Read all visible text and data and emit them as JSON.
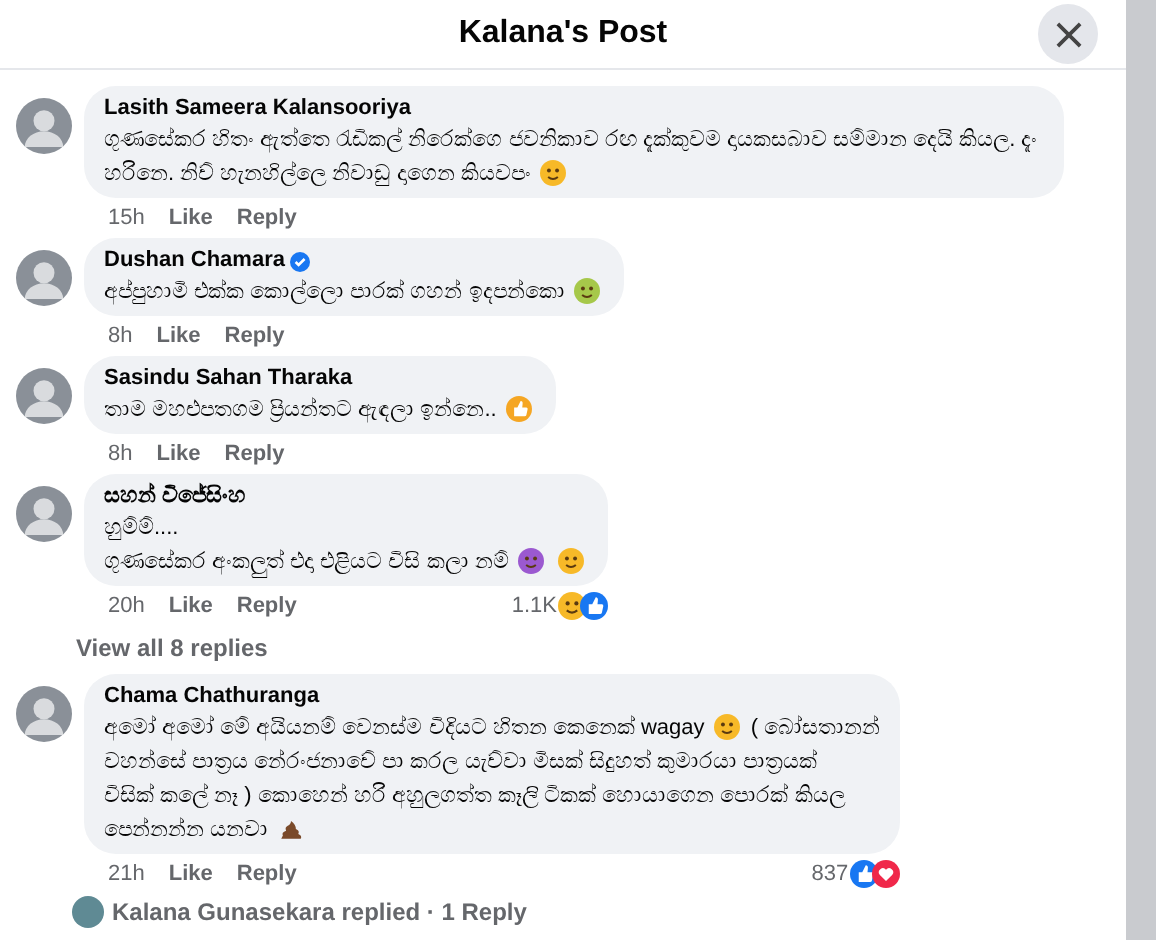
{
  "dialog": {
    "title": "Kalana's Post"
  },
  "comments": [
    {
      "author": "Lasith Sameera Kalansooriya",
      "verified": false,
      "content": [
        {
          "kind": "text",
          "text": "ගුණසේකර හිතං ඇත්තෙ රැඩිකල් නිරෙක්ගෙ ජවනිකාව රඟ දැක්කුවම දායකසබාව සම්මාන දෙයි කියල. දැං හරිනෙ. නිව් හැනහිල්ලෙ නිවාඩු දාගෙන කියවපං"
        },
        {
          "kind": "kiss"
        }
      ],
      "time": "15h",
      "like": "Like",
      "reply": "Reply"
    },
    {
      "author": "Dushan Chamara",
      "verified": true,
      "content": [
        {
          "kind": "text",
          "text": "අප්පුහාමි එක්ක කොල්ලො පාරක් ගහන් ඉදපන්කො"
        },
        {
          "kind": "sick"
        }
      ],
      "time": "8h",
      "like": "Like",
      "reply": "Reply"
    },
    {
      "author": "Sasindu Sahan Tharaka",
      "verified": false,
      "content": [
        {
          "kind": "text",
          "text": "තාම මහළුපතගම ප්‍රියන්තට ඇඳලා ඉන්නෙ.."
        },
        {
          "kind": "thumb"
        }
      ],
      "time": "8h",
      "like": "Like",
      "reply": "Reply"
    },
    {
      "author": "සහන් විජේසිංහ",
      "verified": false,
      "content": [
        {
          "kind": "text",
          "text": "හුම්ම්...."
        },
        {
          "kind": "break"
        },
        {
          "kind": "text",
          "text": "ගුණසේකර අංකලුත් එදා එළියට විසි කලා නම්"
        },
        {
          "kind": "shock"
        },
        {
          "kind": "smirk"
        }
      ],
      "time": "20h",
      "like": "Like",
      "reply": "Reply",
      "reaction_count": "1.1K",
      "reactions": [
        {
          "kind": "haha"
        },
        {
          "kind": "like"
        }
      ],
      "view_replies": "View all 8 replies"
    },
    {
      "author": "Chama Chathuranga",
      "verified": false,
      "content": [
        {
          "kind": "text",
          "text": "අමෝ අමෝ මේ අයියනම් වෙනස්ම විදියට හිතන කෙනෙක් wagay"
        },
        {
          "kind": "tired"
        },
        {
          "kind": "text",
          "text": "( බෝසතානන්"
        },
        {
          "kind": "break"
        },
        {
          "kind": "text",
          "text": "වහන්සේ පාත්‍රය නේරංජනාවේ පා කරල යැව්වා මිසක් සිදුහත් කුමාරයා පාත්‍රයක්"
        },
        {
          "kind": "break"
        },
        {
          "kind": "text",
          "text": "විසික් කලේ නෑ ) කොහෙන් හරි අහුලගත්ත කෑලි ටිකක් හොයාගෙන පොරක් කියල"
        },
        {
          "kind": "break"
        },
        {
          "kind": "text",
          "text": "පෙන්නන්න යනවා"
        },
        {
          "kind": "poop"
        }
      ],
      "time": "21h",
      "like": "Like",
      "reply": "Reply",
      "reaction_count": "837",
      "reactions": [
        {
          "kind": "like"
        },
        {
          "kind": "love"
        }
      ],
      "replied": "Kalana Gunasekara replied · 1 Reply"
    }
  ]
}
